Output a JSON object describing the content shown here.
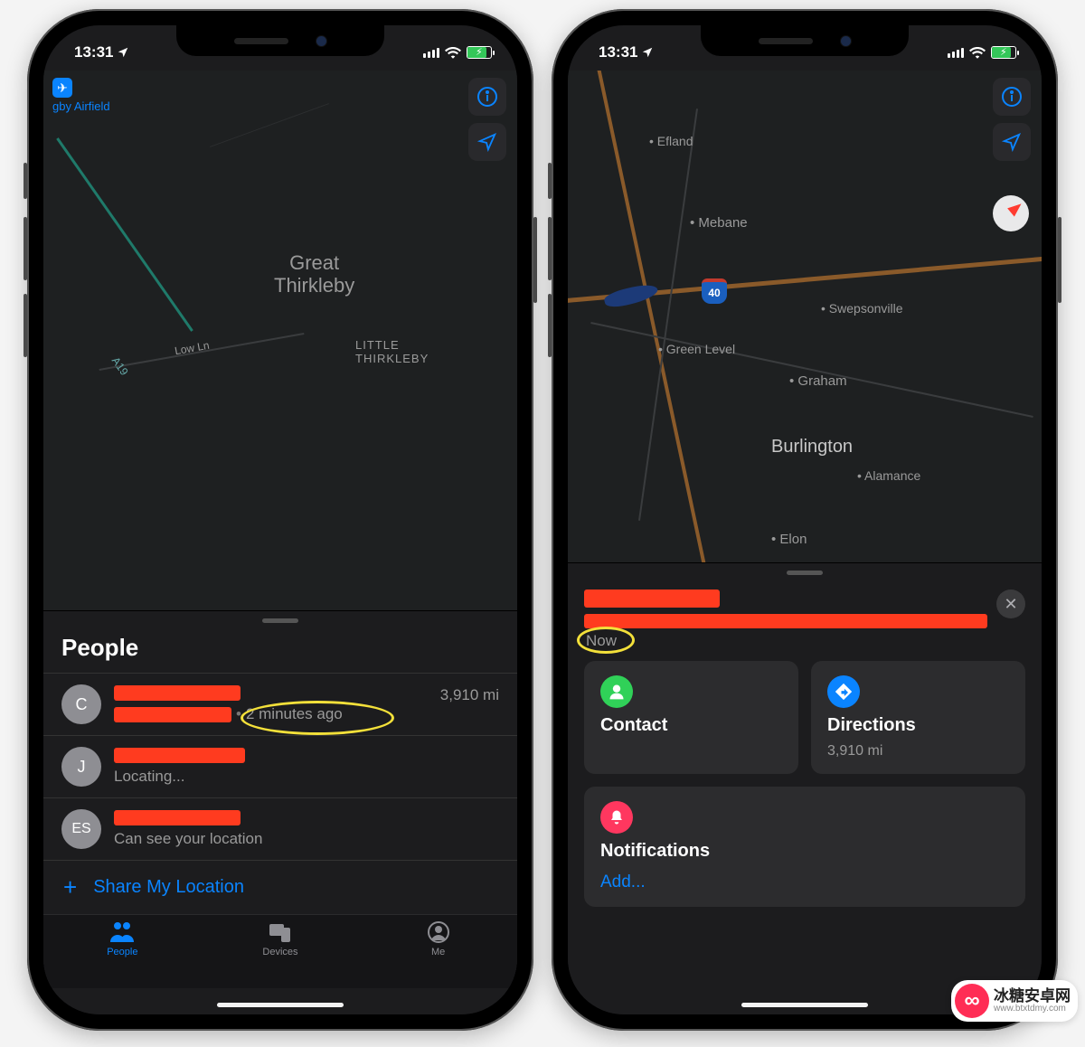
{
  "status": {
    "time": "13:31"
  },
  "left": {
    "poi_label": "gby Airfield",
    "map_places": {
      "great": "Great",
      "thirkleby": "Thirkleby",
      "little": "LITTLE\nTHIRKLEBY",
      "a19": "A19",
      "lowln": "Low Ln"
    },
    "sheet_title": "People",
    "people": [
      {
        "initial": "C",
        "time_text": "2 minutes ago",
        "distance": "3,910 mi"
      },
      {
        "initial": "J",
        "status": "Locating..."
      },
      {
        "initial": "ES",
        "status": "Can see your location"
      }
    ],
    "share_label": "Share My Location",
    "tabs": {
      "people": "People",
      "devices": "Devices",
      "me": "Me"
    }
  },
  "right": {
    "map_places": {
      "efland": "Efland",
      "mebane": "Mebane",
      "swepsonville": "Swepsonville",
      "greenlevel": "Green Level",
      "graham": "Graham",
      "burlington": "Burlington",
      "alamance": "Alamance",
      "elon": "Elon",
      "i40": "40"
    },
    "now_label": "Now",
    "cards": {
      "contact": "Contact",
      "directions": "Directions",
      "directions_sub": "3,910 mi",
      "notifications": "Notifications",
      "add": "Add..."
    }
  },
  "watermark": {
    "main": "冰糖安卓网",
    "sub": "www.btxtdmy.com"
  }
}
